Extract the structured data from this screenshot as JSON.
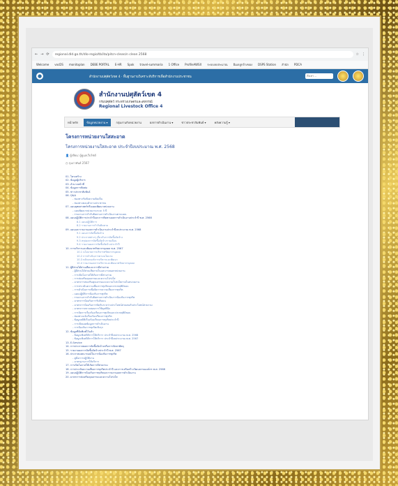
{
  "browser": {
    "url": "regional.dld.go.th/dlo-regio/tb/ita/pitcn-clean/n clean 2568",
    "bookmarks": [
      "Welcome",
      "vocDS",
      "monitoplan",
      "DEBE PORTAL",
      "E-HR",
      "Spok",
      "travel-summaria",
      "1 Office",
      "ProfileAWSX",
      "ระบบงบประมาณ",
      "อีเมลลูกจ้างของ",
      "DSPS Station",
      "สำนัก",
      "PDCA"
    ]
  },
  "topbar": {
    "text": "สำนักงานปศุสัตว์เขต 4 · พื้นฐานงานวิเคราะห์บริการเพื่อสำนักงานประชาชน",
    "search_placeholder": "ค้นหา..."
  },
  "org": {
    "name": "สำนักงานปศุสัตว์เขต 4",
    "sub": "กรมปศุสัตว์ กระทรวงเกษตรและสหกรณ์",
    "en": "Regional Livestock Office 4"
  },
  "nav": [
    "หน้าหลัก",
    "ข้อมูลหน่วยงาน ▾",
    "กลุ่มงานกับหน่วยงาน",
    "ผลการดำเนินงาน ▾",
    "ข่าวประชาสัมพันธ์ ▾",
    "คลังความรู้ ▾"
  ],
  "page": {
    "title": "โครงการหน่วยงานใสสะอาด",
    "subtitle": "โครงการหน่วยงานใสสะอาด ประจำปีงบประมาณ พ.ศ. 2568",
    "author": "ผู้เขียน: ผู้ดูแลเว็บไซต์",
    "date": "กุมภาพันธ์ 2567"
  },
  "toc": [
    {
      "level": 1,
      "text": "01. โครงสร้าง"
    },
    {
      "level": 1,
      "text": "02. ข้อมูลผู้บริหาร"
    },
    {
      "level": 1,
      "text": "03. อำนาจหน้าที่"
    },
    {
      "level": 1,
      "text": "04. ข้อมูลการติดต่อ"
    },
    {
      "level": 1,
      "text": "05. ข่าวประชาสัมพันธ์"
    },
    {
      "level": 1,
      "text": "06. Q&A"
    },
    {
      "level": 2,
      "text": "- ช่องทางรับฟังความคิดเห็น"
    },
    {
      "level": 2,
      "text": "- ช่องทางตอบคำถามประชาชน"
    },
    {
      "level": 1,
      "text": "07. แผนยุทธศาสตร์หรือแผนพัฒนาหน่วยงาน"
    },
    {
      "level": 2,
      "text": "- แผนพัฒนาหน่วยงานระยะ 5 ปี"
    },
    {
      "level": 2,
      "text": "- รายงานการกำกับติดตามการดำเนินงานตามแผน"
    },
    {
      "level": 1,
      "text": "08. แผนปฏิบัติการประจำปีและการติดตามผลการดำเนินงานประจำปี พ.ศ. 2568"
    },
    {
      "level": 3,
      "text": "8.1 แผนปฏิบัติการ"
    },
    {
      "level": 3,
      "text": "8.2 รายงานการกำกับติดตาม"
    },
    {
      "level": 1,
      "text": "09. แผนและรายงานผลการดำเนินงานประจำปีงบประมาณ พ.ศ. 2568"
    },
    {
      "level": 3,
      "text": "9.1 แผนการจัดซื้อจัดจ้าง"
    },
    {
      "level": 3,
      "text": "9.2 ประกาศต่างๆ เกี่ยวกับการจัดซื้อจัดจ้าง"
    },
    {
      "level": 3,
      "text": "9.3 สรุปผลการจัดซื้อจัดจ้างรายเดือน"
    },
    {
      "level": 3,
      "text": "9.4 รายงานผลการจัดซื้อจัดจ้างประจำปี"
    },
    {
      "level": 1,
      "text": "10. การบริหารและพัฒนาทรัพยากรบุคคล พ.ศ. 2567"
    },
    {
      "level": 3,
      "text": "10.1 นโยบายการบริหารทรัพยากรบุคคล"
    },
    {
      "level": 3,
      "text": "10.2 การดำเนินการตามนโยบาย"
    },
    {
      "level": 3,
      "text": "10.3 หลักเกณฑ์การบริหารและพัฒนา"
    },
    {
      "level": 3,
      "text": "10.4 รายงานผลการบริหารและพัฒนาทรัพยากรบุคคล"
    },
    {
      "level": 1,
      "text": "11. ผู้มีส่วนได้ส่วนเสียและการมีส่วนร่วม"
    },
    {
      "level": 2,
      "text": "- ผู้มีส่วนได้ส่วนเสียภายในและภายนอกหน่วยงาน"
    },
    {
      "level": 2,
      "text": "- การเปิดโอกาสให้เกิดการมีส่วนร่วม"
    },
    {
      "level": 2,
      "text": "- การส่งเสริมคุณธรรมและความโปร่งใส"
    },
    {
      "level": 2,
      "text": "- มาตรการส่งเสริมคุณธรรมและความโปร่งใสภายในหน่วยงาน"
    },
    {
      "level": 2,
      "text": "- การประเมินความเสี่ยงการทุจริตและประพฤติมิชอบ"
    },
    {
      "level": 2,
      "text": "- การดำเนินการเพื่อจัดการความเสี่ยงการทุจริต"
    },
    {
      "level": 2,
      "text": "- แผนปฏิบัติการป้องกันการทุจริต"
    },
    {
      "level": 2,
      "text": "- รายงานการกำกับติดตามการดำเนินการป้องกันการทุจริต"
    },
    {
      "level": 2,
      "text": "- มาตรการป้องกันการรับสินบน"
    },
    {
      "level": 2,
      "text": "- มาตรการป้องกันการขัดกันระหว่างประโยชน์ส่วนตนกับประโยชน์ส่วนรวม"
    },
    {
      "level": 2,
      "text": "- มาตรการตรวจสอบการใช้ดุลพินิจ"
    },
    {
      "level": 2,
      "text": "- การจัดการเรื่องร้องเรียนการทุจริตและประพฤติมิชอบ"
    },
    {
      "level": 2,
      "text": "- ช่องทางแจ้งเรื่องร้องเรียนการทุจริต"
    },
    {
      "level": 2,
      "text": "- ข้อมูลสถิติเรื่องร้องเรียนการทุจริตประจำปี"
    },
    {
      "level": 2,
      "text": "- การเปิดเผยข้อมูลการดำเนินงาน"
    },
    {
      "level": 2,
      "text": "- การป้องกันการทุจริตเชิงรุก"
    },
    {
      "level": 1,
      "text": "12. ข้อมูลที่จัดพิมพ์ไว้แล้ว"
    },
    {
      "level": 2,
      "text": "- ข้อมูลเชิงสถิติการให้บริการ ประจำปีงบประมาณ พ.ศ. 2568"
    },
    {
      "level": 2,
      "text": "- ข้อมูลเชิงสถิติการให้บริการ ประจำปีงบประมาณ พ.ศ. 2567"
    },
    {
      "level": 1,
      "text": "13. E-Service"
    },
    {
      "level": 1,
      "text": "14. การประกาศผลการจัดซื้อจัดจ้างหรือการจัดหาพัสดุ"
    },
    {
      "level": 1,
      "text": "15. รายงานผลการจัดซื้อจัดจ้างประจำปี พ.ศ. 2567"
    },
    {
      "level": 1,
      "text": "16. ประกาศเจตนารมณ์ในการป้องกันการทุจริต"
    },
    {
      "level": 2,
      "text": "- คู่มือการปฏิบัติงาน"
    },
    {
      "level": 2,
      "text": "- มาตรฐานการให้บริการ"
    },
    {
      "level": 1,
      "text": "17. การเปิดโอกาสให้เกิดการมีส่วนร่วม"
    },
    {
      "level": 1,
      "text": "18. การประเมินความเสี่ยงการทุจริตประจำปี และการเสริมสร้างวัฒนธรรมองค์กร พ.ศ. 2568"
    },
    {
      "level": 1,
      "text": "19. แผนปฏิบัติการป้องกันการทุจริตและรายงานผลการดำเนินงาน"
    },
    {
      "level": 1,
      "text": "20. มาตรการส่งเสริมคุณธรรมและความโปร่งใส"
    }
  ]
}
